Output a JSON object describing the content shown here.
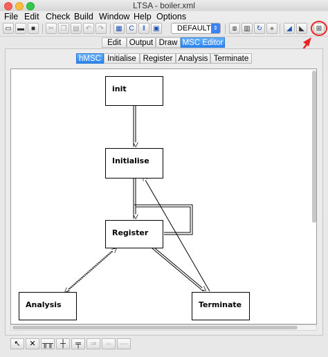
{
  "window": {
    "title": "LTSA - boiler.xml"
  },
  "menu": [
    "File",
    "Edit",
    "Check",
    "Build",
    "Window",
    "Help",
    "Options"
  ],
  "toolbar": {
    "icons": [
      "new-file-icon",
      "open-folder-icon",
      "save-icon",
      "cut-icon",
      "copy-icon",
      "paste-icon",
      "undo-icon",
      "redo-icon",
      "parse-icon",
      "compile-icon",
      "compose-icon",
      "safety-check-icon",
      "target-select-icon",
      "stop-icon",
      "pause-icon",
      "reset-icon",
      "run-icon",
      "minimize-icon",
      "draw-icon",
      "new-feature-icon"
    ],
    "target": "DEFAULT"
  },
  "view_tabs": [
    "Edit",
    "Output",
    "Draw",
    "MSC Editor"
  ],
  "active_view_tab": "MSC Editor",
  "scenario_tabs": [
    "hMSC",
    "Initialise",
    "Register",
    "Analysis",
    "Terminate"
  ],
  "active_scenario_tab": "hMSC",
  "diagram": {
    "nodes": {
      "init": "init",
      "initialise": "Initialise",
      "register": "Register",
      "analysis": "Analysis",
      "terminate": "Terminate"
    }
  },
  "bottom_tools": [
    "select-tool-icon",
    "delete-tool-icon",
    "instance-tool-icon",
    "message-tool-icon",
    "condition-tool-icon",
    "arrow-right-tool-icon",
    "arrow-both-tool-icon",
    "dash-tool-icon"
  ],
  "colors": {
    "accent": "#2a84f0",
    "callout": "#e22222"
  }
}
